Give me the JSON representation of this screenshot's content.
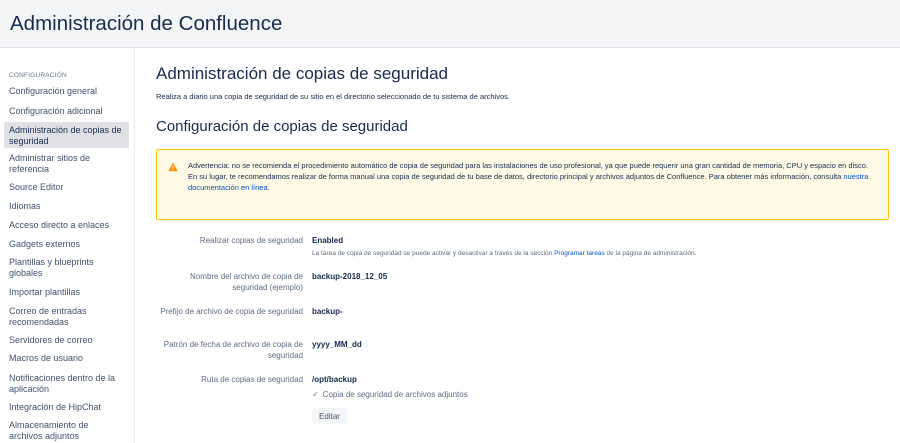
{
  "header": {
    "title": "Administración de Confluence"
  },
  "sidebar": {
    "heading": "CONFIGURACIÓN",
    "items": [
      {
        "label": "Configuración general"
      },
      {
        "label": "Configuración adicional"
      },
      {
        "label": "Administración de copias de seguridad",
        "active": true
      },
      {
        "label": "Administrar sitios de referencia"
      },
      {
        "label": "Source Editor"
      },
      {
        "label": "Idiomas"
      },
      {
        "label": "Acceso directo a enlaces"
      },
      {
        "label": "Gadgets externos"
      },
      {
        "label": "Plantillas y blueprints globales"
      },
      {
        "label": "Importar plantillas"
      },
      {
        "label": "Correo de entradas recomendadas"
      },
      {
        "label": "Servidores de correo"
      },
      {
        "label": "Macros de usuario"
      },
      {
        "label": "Notificaciones dentro de la aplicación"
      },
      {
        "label": "Integración de HipChat"
      },
      {
        "label": "Almacenamiento de archivos adjuntos"
      }
    ]
  },
  "main": {
    "title": "Administración de copias de seguridad",
    "description": "Realiza a diario una copia de seguridad de su sitio en el directorio seleccionado de tu sistema de archivos.",
    "section_title": "Configuración de copias de seguridad",
    "warning": {
      "line1": "Advertencia: no se recomienda el procedimiento automático de copia de seguridad para las instalaciones de uso profesional, ya que puede requerir una gran cantidad de memoria, CPU y espacio en disco.",
      "line2_prefix": "En su lugar, te recomendamos realizar de forma manual una copia de seguridad de tu base de datos, directorio principal y archivos adjuntos de Confluence. Para obtener más información, consulta ",
      "line2_link": "nuestra documentación en línea",
      "line2_suffix": "."
    },
    "settings": {
      "backup_enabled": {
        "label": "Realizar copias de seguridad",
        "value": "Enabled",
        "note_prefix": "La tarea de copia de seguridad se puede activar y desactivar a través de la sección ",
        "note_link": "Programar tareas",
        "note_suffix": " de la página de administración."
      },
      "file_name": {
        "label": "Nombre del archivo de copia de seguridad (ejemplo)",
        "value": "backup-2018_12_05"
      },
      "file_prefix": {
        "label": "Prefijo de archivo de copia de seguridad",
        "value": "backup-"
      },
      "date_pattern": {
        "label": "Patrón de fecha de archivo de copia de seguridad",
        "value": "yyyy_MM_dd"
      },
      "backup_path": {
        "label": "Ruta de copias de seguridad",
        "value": "/opt/backup"
      },
      "attachments_checkbox": {
        "label": "Copia de seguridad de archivos adjuntos",
        "checked": true
      }
    },
    "edit_button": "Editar"
  },
  "colors": {
    "accent": "#0052cc",
    "warning_border": "#ffc400",
    "warning_bg": "#fffae6",
    "warning_icon": "#ff8b00"
  },
  "icons": {
    "warning": "warning-icon",
    "check": "check-icon"
  }
}
